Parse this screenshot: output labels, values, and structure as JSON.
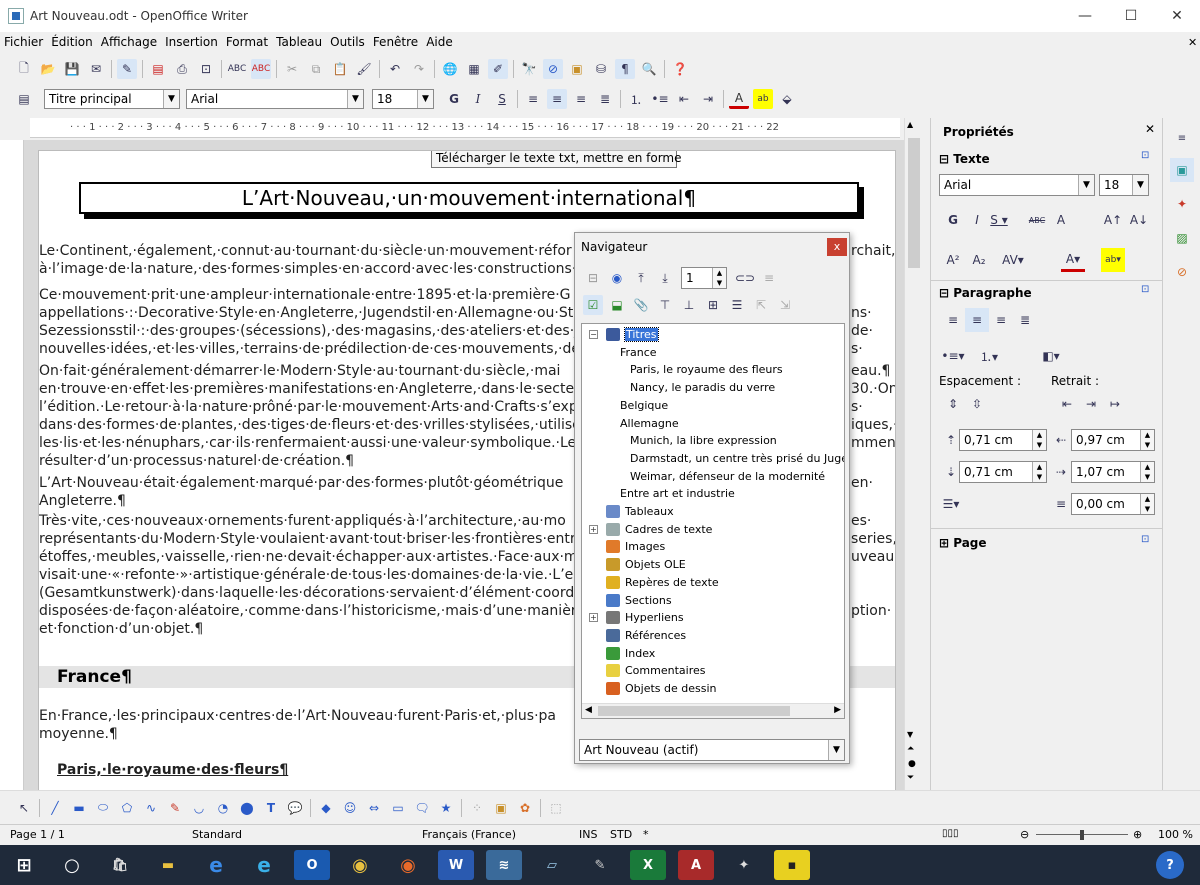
{
  "window": {
    "title": "Art Nouveau.odt - OpenOffice Writer",
    "min": "—",
    "max": "☐",
    "close": "✕"
  },
  "menu": [
    "Fichier",
    "Édition",
    "Affichage",
    "Insertion",
    "Format",
    "Tableau",
    "Outils",
    "Fenêtre",
    "Aide"
  ],
  "formatting": {
    "style": "Titre principal",
    "font": "Arial",
    "size": "18"
  },
  "tooltip": "Télécharger le texte txt, mettre en forme",
  "document": {
    "title": "L’Art·Nouveau,·un·mouvement·international¶",
    "lines": [
      "        Le·Continent,·également,·connut·au·tournant·du·siècle·un·mouvement·réfor",
      "à·l’image·de·la·nature,·des·formes·simples·en·accord·avec·les·constructions·:·l’A",
      "        Ce·mouvement·prit·une·ampleur·internationale·entre·1895·et·la·première·G",
      "appellations·:·Decorative·Style·en·Angleterre,·Jugendstil·en·Allemagne·ou·Stilo",
      "Sezessionsstil·:·des·groupes·(sécessions),·des·magasins,·des·ateliers·et·des·j",
      "nouvelles·idées,·et·les·villes,·terrains·de·prédilection·de·ces·mouvements,·devin",
      "        On·fait·généralement·démarrer·le·Modern·Style·au·tournant·du·siècle,·mai",
      "en·trouve·en·effet·les·premières·manifestations·en·Angleterre,·dans·le·secteur·g",
      "l’édition.·Le·retour·à·la·nature·prôné·par·le·mouvement·Arts·and·Crafts·s’exprima",
      "dans·des·formes·de·plantes,·des·tiges·de·fleurs·et·des·vrilles·stylisées,·utilisées",
      "les·lis·et·les·nénuphars,·car·ils·renfermaient·aussi·une·valeur·symbolique.·Les·fo",
      "résulter·d’un·processus·naturel·de·création.¶",
      "        L’Art·Nouveau·était·également·marqué·par·des·formes·plutôt·géométrique",
      "Angleterre.¶",
      "        Très·vite,·ces·nouveaux·ornements·furent·appliqués·à·l’architecture,·au·mo",
      "représentants·du·Modern·Style·voulaient·avant·tout·briser·les·frontières·entre·l’a",
      "étoffes,·meubles,·vaisselle,·rien·ne·devait·échapper·aux·artistes.·Face·aux·marc",
      "visait·une·«·refonte·»·artistique·générale·de·tous·les·domaines·de·la·vie.·L’espa",
      "(Gesamtkunstwerk)·dans·laquelle·les·décorations·servaient·d’élément·coordinat",
      "disposées·de·façon·aléatoire,·comme·dans·l’historicisme,·mais·d’une·manière·",
      "et·fonction·d’un·objet.¶"
    ],
    "right_fragments": [
      "rchait,·",
      "ns·",
      "de·",
      "s·",
      "eau.¶",
      "30.·On·",
      "s·",
      "iques,·",
      "mment",
      "en·",
      "es·",
      "series,",
      "uveau·",
      "ption·"
    ],
    "heading_france": "France¶",
    "france_lines": [
      "        En·France,·les·principaux·centres·de·l’Art·Nouveau·furent·Paris·et,·plus·pa",
      "moyenne.¶"
    ],
    "heading_paris": "Paris,·le·royaume·des·fleurs¶"
  },
  "navigator": {
    "title": "Navigateur",
    "close": "x",
    "page_num": "1",
    "items": [
      {
        "label": "Titres",
        "level": 0,
        "icon": "headings-icon",
        "exp": "−",
        "color": "#3c5a9c"
      },
      {
        "label": "France",
        "level": 1
      },
      {
        "label": "Paris, le royaume des fleurs",
        "level": 2
      },
      {
        "label": "Nancy, le paradis du verre",
        "level": 2
      },
      {
        "label": "Belgique",
        "level": 1
      },
      {
        "label": "Allemagne",
        "level": 1
      },
      {
        "label": "Munich, la libre expression",
        "level": 2
      },
      {
        "label": "Darmstadt, un centre très prisé du Jugend",
        "level": 2
      },
      {
        "label": "Weimar, défenseur de la modernité",
        "level": 2
      },
      {
        "label": "Entre art et industrie",
        "level": 1
      },
      {
        "label": "Tableaux",
        "level": 0,
        "icon": "table-icon",
        "color": "#6a8ac8"
      },
      {
        "label": "Cadres de texte",
        "level": 0,
        "icon": "frame-icon",
        "exp": "+",
        "color": "#9aa"
      },
      {
        "label": "Images",
        "level": 0,
        "icon": "image-icon",
        "color": "#e07a2a"
      },
      {
        "label": "Objets OLE",
        "level": 0,
        "icon": "ole-icon",
        "color": "#c89a2a"
      },
      {
        "label": "Repères de texte",
        "level": 0,
        "icon": "bookmark-icon",
        "color": "#e0b020"
      },
      {
        "label": "Sections",
        "level": 0,
        "icon": "section-icon",
        "color": "#4a7ac8"
      },
      {
        "label": "Hyperliens",
        "level": 0,
        "icon": "link-icon",
        "exp": "+",
        "color": "#777"
      },
      {
        "label": "Références",
        "level": 0,
        "icon": "reference-icon",
        "color": "#4a6a9a"
      },
      {
        "label": "Index",
        "level": 0,
        "icon": "index-icon",
        "color": "#3a9a3a"
      },
      {
        "label": "Commentaires",
        "level": 0,
        "icon": "comment-icon",
        "color": "#e8d040"
      },
      {
        "label": "Objets de dessin",
        "level": 0,
        "icon": "drawing-icon",
        "color": "#d86020"
      }
    ],
    "document_select": "Art Nouveau (actif)"
  },
  "properties": {
    "title": "Propriétés",
    "close": "✕",
    "text_section": "Texte",
    "font": "Arial",
    "size": "18",
    "paragraph_section": "Paragraphe",
    "spacing_label": "Espacement :",
    "indent_label": "Retrait :",
    "above": "0,71 cm",
    "below": "0,71 cm",
    "indent_before": "0,97 cm",
    "indent_after": "1,07 cm",
    "first_line": "0,00 cm",
    "page_section": "Page"
  },
  "status": {
    "page": "Page 1 / 1",
    "style": "Standard",
    "language": "Français (France)",
    "ins": "INS",
    "std": "STD",
    "star": "*",
    "zoom": "100 %"
  },
  "taskbar_apps": [
    "start",
    "search",
    "store",
    "explorer",
    "edge",
    "ie",
    "outlook",
    "chrome",
    "firefox",
    "word",
    "writer",
    "paint",
    "draw",
    "excel",
    "access",
    "misc",
    "notes"
  ]
}
